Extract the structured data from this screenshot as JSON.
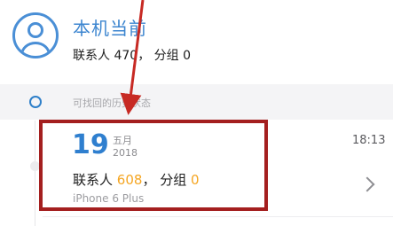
{
  "current": {
    "title": "本机当前",
    "contacts_label": "联系人",
    "contacts_count": "470",
    "separator": "，",
    "groups_label": "分组",
    "groups_count": "0"
  },
  "history": {
    "section_label": "可找回的历史状态",
    "entry": {
      "day": "19",
      "month": "五月",
      "year": "2018",
      "time": "18:13",
      "contacts_label": "联系人",
      "contacts_count": "608",
      "separator": "，",
      "groups_label": "分组",
      "groups_count": "0",
      "device": "iPhone 6 Plus"
    }
  },
  "colors": {
    "accent": "#3d86d0",
    "highlight": "#a41f1f",
    "count_orange": "#f5a623"
  },
  "icons": [
    "avatar-icon",
    "timeline-ring-icon",
    "chevron-right-icon"
  ]
}
